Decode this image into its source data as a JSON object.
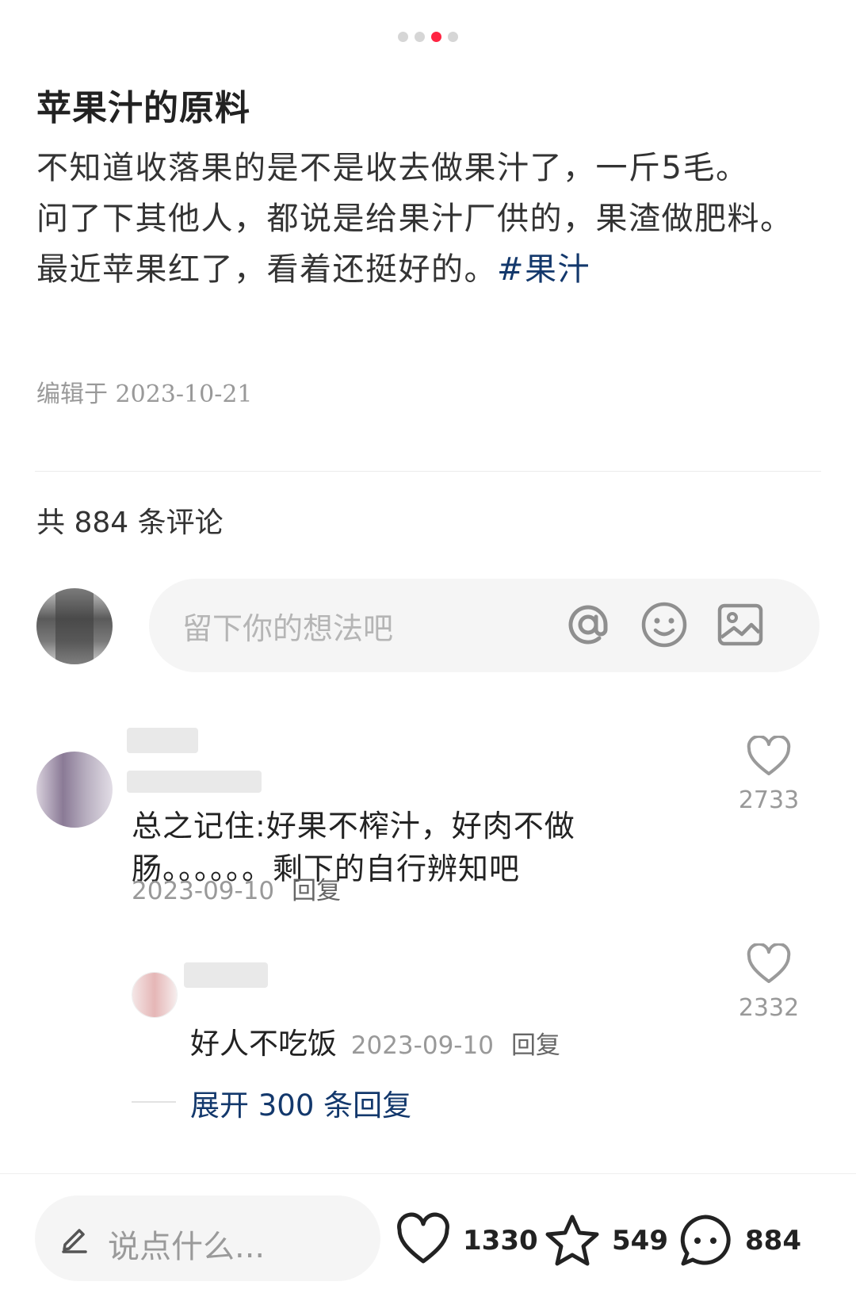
{
  "carousel": {
    "dot_count": 4,
    "active_index": 2
  },
  "post": {
    "title": "苹果汁的原料",
    "body_line1": "不知道收落果的是不是收去做果汁了，一斤5毛。",
    "body_line2": "问了下其他人，都说是给果汁厂供的，果渣做肥料。",
    "body_line3": "最近苹果红了，看着还挺好的。",
    "hashtag": "#果汁",
    "edited": "编辑于 2023-10-21"
  },
  "comments_header": {
    "label": "共 884 条评论"
  },
  "comment_input": {
    "placeholder": "留下你的想法吧",
    "icons": [
      "at-icon",
      "emoji-icon",
      "image-icon"
    ]
  },
  "comments": [
    {
      "text": "总之记住:好果不榨汁，好肉不做肠。。。。。。剩下的自行辨知吧",
      "date": "2023-09-10",
      "reply_label": "回复",
      "likes": "2733",
      "replies": [
        {
          "text": "好人不吃饭",
          "date": "2023-09-10",
          "reply_label": "回复",
          "likes": "2332"
        }
      ],
      "expand_label": "展开 300 条回复"
    }
  ],
  "bottom_bar": {
    "say_placeholder": "说点什么...",
    "like_count": "1330",
    "favorite_count": "549",
    "comment_count": "884"
  },
  "colors": {
    "accent": "#ff2442",
    "link": "#13386c",
    "muted": "#999999"
  }
}
